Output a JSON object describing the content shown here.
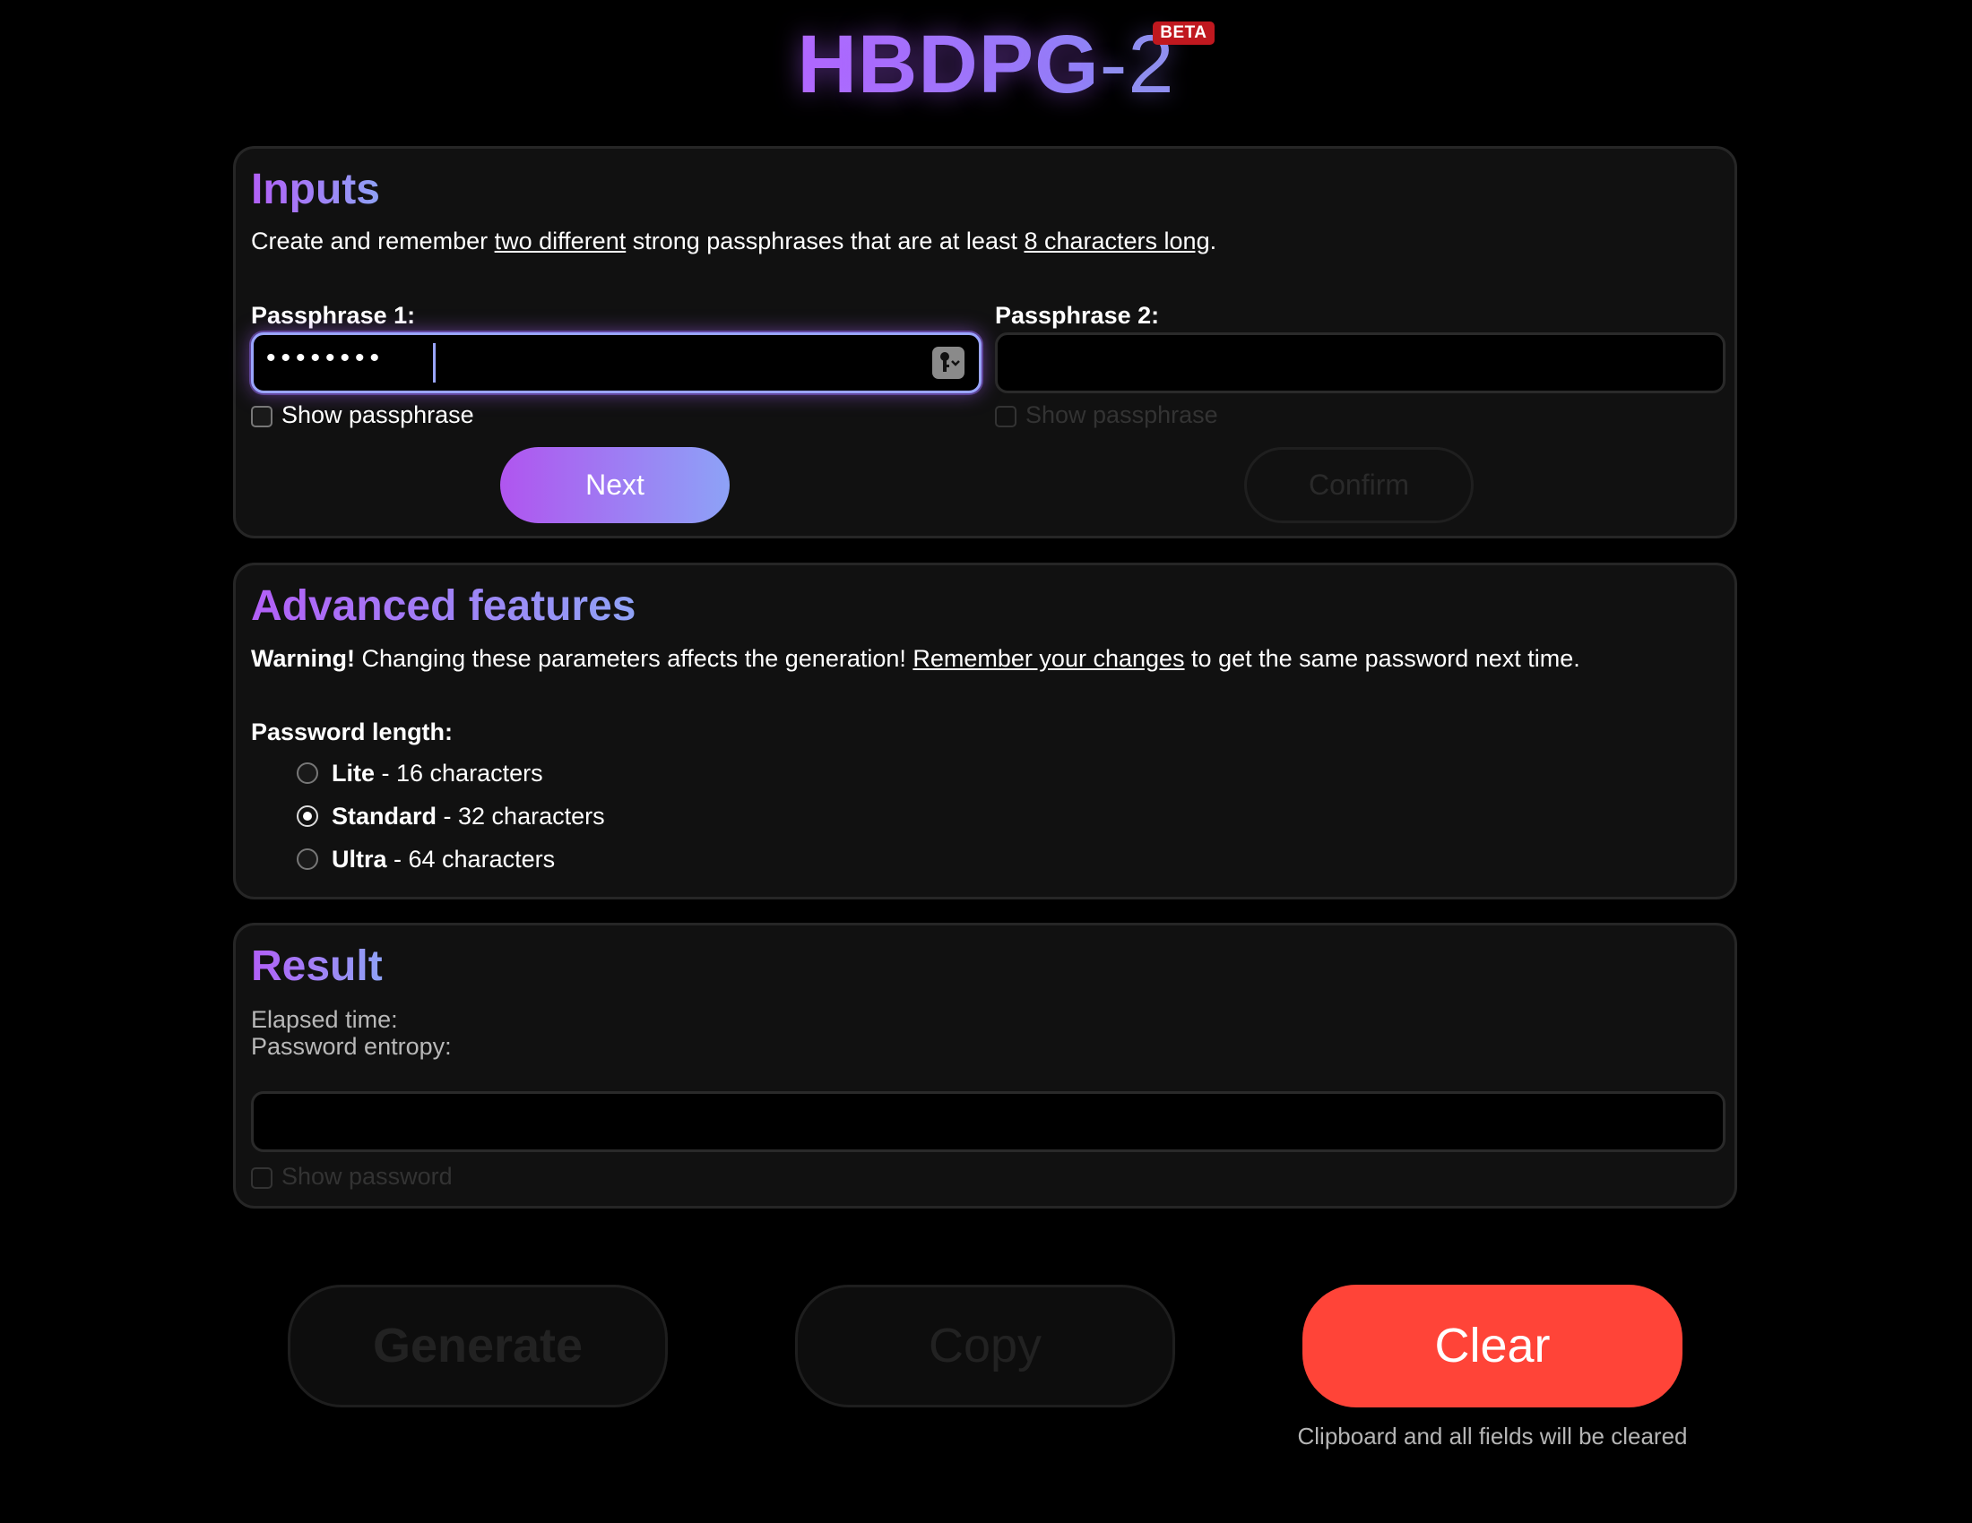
{
  "app": {
    "logo_main": "HBDPG",
    "logo_suffix": "-2",
    "logo_badge": "BETA"
  },
  "inputs": {
    "title": "Inputs",
    "desc_prefix": "Create and remember ",
    "desc_link1": "two different",
    "desc_middle": " strong passphrases that are at least ",
    "desc_link2": "8 characters long",
    "desc_suffix": ".",
    "passphrase1": {
      "label": "Passphrase 1:",
      "masked_value": "••••••••",
      "show_label": "Show passphrase",
      "button": "Next"
    },
    "passphrase2": {
      "label": "Passphrase 2:",
      "masked_value": "",
      "show_label": "Show passphrase",
      "button": "Confirm"
    }
  },
  "advanced": {
    "title": "Advanced features",
    "warning_bold": "Warning!",
    "warning_text": " Changing these parameters affects the generation! ",
    "warning_link": "Remember your changes",
    "warning_suffix": " to get the same password next time.",
    "length_label": "Password length:",
    "options": [
      {
        "name": "Lite",
        "desc": " - 16 characters",
        "checked": false
      },
      {
        "name": "Standard",
        "desc": " - 32 characters",
        "checked": true
      },
      {
        "name": "Ultra",
        "desc": " - 64 characters",
        "checked": false
      }
    ]
  },
  "result": {
    "title": "Result",
    "elapsed_label": "Elapsed time:",
    "entropy_label": "Password entropy:",
    "password_value": "",
    "show_label": "Show password"
  },
  "actions": {
    "generate": "Generate",
    "copy": "Copy",
    "clear": "Clear",
    "clear_caption": "Clipboard and all fields will be cleared"
  },
  "colors": {
    "accent_start": "#b25ff7",
    "accent_end": "#8fa2f6",
    "clear_red": "#ff4438",
    "badge_red": "#c0181f"
  }
}
